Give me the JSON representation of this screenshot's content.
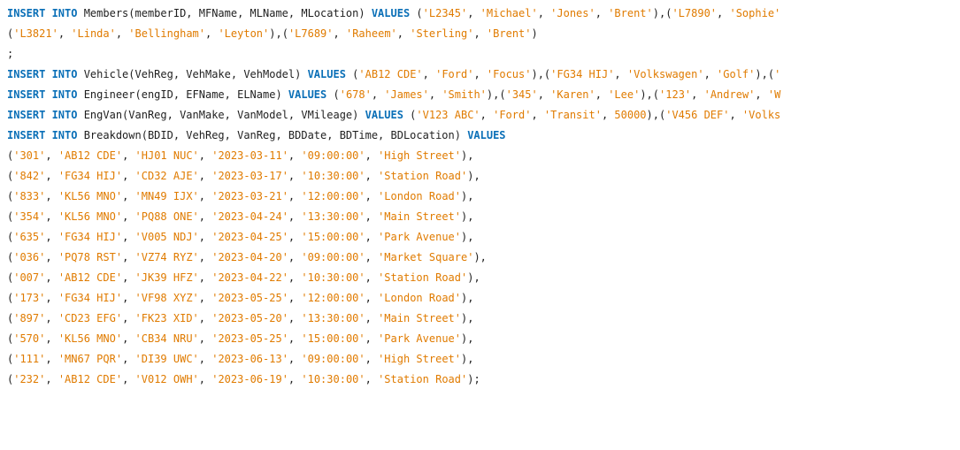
{
  "colors": {
    "keyword": "#0a6fb7",
    "string": "#e07b00",
    "text": "#1f1f1f",
    "background": "#ffffff"
  },
  "lines": [
    [
      {
        "t": "kw",
        "v": "INSERT INTO"
      },
      {
        "t": "ident",
        "v": " Members(memberID, MFName, MLName, MLocation) "
      },
      {
        "t": "kw",
        "v": "VALUES"
      },
      {
        "t": "punc",
        "v": " ("
      },
      {
        "t": "str",
        "v": "'L2345'"
      },
      {
        "t": "punc",
        "v": ", "
      },
      {
        "t": "str",
        "v": "'Michael'"
      },
      {
        "t": "punc",
        "v": ", "
      },
      {
        "t": "str",
        "v": "'Jones'"
      },
      {
        "t": "punc",
        "v": ", "
      },
      {
        "t": "str",
        "v": "'Brent'"
      },
      {
        "t": "punc",
        "v": "),("
      },
      {
        "t": "str",
        "v": "'L7890'"
      },
      {
        "t": "punc",
        "v": ", "
      },
      {
        "t": "str",
        "v": "'Sophie'"
      }
    ],
    [
      {
        "t": "punc",
        "v": "("
      },
      {
        "t": "str",
        "v": "'L3821'"
      },
      {
        "t": "punc",
        "v": ", "
      },
      {
        "t": "str",
        "v": "'Linda'"
      },
      {
        "t": "punc",
        "v": ", "
      },
      {
        "t": "str",
        "v": "'Bellingham'"
      },
      {
        "t": "punc",
        "v": ", "
      },
      {
        "t": "str",
        "v": "'Leyton'"
      },
      {
        "t": "punc",
        "v": "),("
      },
      {
        "t": "str",
        "v": "'L7689'"
      },
      {
        "t": "punc",
        "v": ", "
      },
      {
        "t": "str",
        "v": "'Raheem'"
      },
      {
        "t": "punc",
        "v": ", "
      },
      {
        "t": "str",
        "v": "'Sterling'"
      },
      {
        "t": "punc",
        "v": ", "
      },
      {
        "t": "str",
        "v": "'Brent'"
      },
      {
        "t": "punc",
        "v": ")"
      }
    ],
    [
      {
        "t": "punc",
        "v": ";"
      }
    ],
    [
      {
        "t": "kw",
        "v": "INSERT INTO"
      },
      {
        "t": "ident",
        "v": " Vehicle(VehReg, VehMake, VehModel) "
      },
      {
        "t": "kw",
        "v": "VALUES"
      },
      {
        "t": "punc",
        "v": " ("
      },
      {
        "t": "str",
        "v": "'AB12 CDE'"
      },
      {
        "t": "punc",
        "v": ", "
      },
      {
        "t": "str",
        "v": "'Ford'"
      },
      {
        "t": "punc",
        "v": ", "
      },
      {
        "t": "str",
        "v": "'Focus'"
      },
      {
        "t": "punc",
        "v": "),("
      },
      {
        "t": "str",
        "v": "'FG34 HIJ'"
      },
      {
        "t": "punc",
        "v": ", "
      },
      {
        "t": "str",
        "v": "'Volkswagen'"
      },
      {
        "t": "punc",
        "v": ", "
      },
      {
        "t": "str",
        "v": "'Golf'"
      },
      {
        "t": "punc",
        "v": "),("
      },
      {
        "t": "str",
        "v": "'"
      }
    ],
    [
      {
        "t": "kw",
        "v": "INSERT INTO"
      },
      {
        "t": "ident",
        "v": " Engineer(engID, EFName, ELName) "
      },
      {
        "t": "kw",
        "v": "VALUES"
      },
      {
        "t": "punc",
        "v": " ("
      },
      {
        "t": "str",
        "v": "'678'"
      },
      {
        "t": "punc",
        "v": ", "
      },
      {
        "t": "str",
        "v": "'James'"
      },
      {
        "t": "punc",
        "v": ", "
      },
      {
        "t": "str",
        "v": "'Smith'"
      },
      {
        "t": "punc",
        "v": "),("
      },
      {
        "t": "str",
        "v": "'345'"
      },
      {
        "t": "punc",
        "v": ", "
      },
      {
        "t": "str",
        "v": "'Karen'"
      },
      {
        "t": "punc",
        "v": ", "
      },
      {
        "t": "str",
        "v": "'Lee'"
      },
      {
        "t": "punc",
        "v": "),("
      },
      {
        "t": "str",
        "v": "'123'"
      },
      {
        "t": "punc",
        "v": ", "
      },
      {
        "t": "str",
        "v": "'Andrew'"
      },
      {
        "t": "punc",
        "v": ", "
      },
      {
        "t": "str",
        "v": "'W"
      }
    ],
    [
      {
        "t": "kw",
        "v": "INSERT INTO"
      },
      {
        "t": "ident",
        "v": " EngVan(VanReg, VanMake, VanModel, VMileage) "
      },
      {
        "t": "kw",
        "v": "VALUES"
      },
      {
        "t": "punc",
        "v": " ("
      },
      {
        "t": "str",
        "v": "'V123 ABC'"
      },
      {
        "t": "punc",
        "v": ", "
      },
      {
        "t": "str",
        "v": "'Ford'"
      },
      {
        "t": "punc",
        "v": ", "
      },
      {
        "t": "str",
        "v": "'Transit'"
      },
      {
        "t": "punc",
        "v": ", "
      },
      {
        "t": "num",
        "v": "50000"
      },
      {
        "t": "punc",
        "v": "),("
      },
      {
        "t": "str",
        "v": "'V456 DEF'"
      },
      {
        "t": "punc",
        "v": ", "
      },
      {
        "t": "str",
        "v": "'Volks"
      }
    ],
    [
      {
        "t": "kw",
        "v": "INSERT INTO"
      },
      {
        "t": "ident",
        "v": " Breakdown(BDID, VehReg, VanReg, BDDate, BDTime, BDLocation) "
      },
      {
        "t": "kw",
        "v": "VALUES"
      }
    ],
    [
      {
        "t": "punc",
        "v": "("
      },
      {
        "t": "str",
        "v": "'301'"
      },
      {
        "t": "punc",
        "v": ", "
      },
      {
        "t": "str",
        "v": "'AB12 CDE'"
      },
      {
        "t": "punc",
        "v": ", "
      },
      {
        "t": "str",
        "v": "'HJ01 NUC'"
      },
      {
        "t": "punc",
        "v": ", "
      },
      {
        "t": "str",
        "v": "'2023-03-11'"
      },
      {
        "t": "punc",
        "v": ", "
      },
      {
        "t": "str",
        "v": "'09:00:00'"
      },
      {
        "t": "punc",
        "v": ", "
      },
      {
        "t": "str",
        "v": "'High Street'"
      },
      {
        "t": "punc",
        "v": "),"
      }
    ],
    [
      {
        "t": "punc",
        "v": "("
      },
      {
        "t": "str",
        "v": "'842'"
      },
      {
        "t": "punc",
        "v": ", "
      },
      {
        "t": "str",
        "v": "'FG34 HIJ'"
      },
      {
        "t": "punc",
        "v": ", "
      },
      {
        "t": "str",
        "v": "'CD32 AJE'"
      },
      {
        "t": "punc",
        "v": ", "
      },
      {
        "t": "str",
        "v": "'2023-03-17'"
      },
      {
        "t": "punc",
        "v": ", "
      },
      {
        "t": "str",
        "v": "'10:30:00'"
      },
      {
        "t": "punc",
        "v": ", "
      },
      {
        "t": "str",
        "v": "'Station Road'"
      },
      {
        "t": "punc",
        "v": "),"
      }
    ],
    [
      {
        "t": "punc",
        "v": "("
      },
      {
        "t": "str",
        "v": "'833'"
      },
      {
        "t": "punc",
        "v": ", "
      },
      {
        "t": "str",
        "v": "'KL56 MNO'"
      },
      {
        "t": "punc",
        "v": ", "
      },
      {
        "t": "str",
        "v": "'MN49 IJX'"
      },
      {
        "t": "punc",
        "v": ", "
      },
      {
        "t": "str",
        "v": "'2023-03-21'"
      },
      {
        "t": "punc",
        "v": ", "
      },
      {
        "t": "str",
        "v": "'12:00:00'"
      },
      {
        "t": "punc",
        "v": ", "
      },
      {
        "t": "str",
        "v": "'London Road'"
      },
      {
        "t": "punc",
        "v": "),"
      }
    ],
    [
      {
        "t": "punc",
        "v": "("
      },
      {
        "t": "str",
        "v": "'354'"
      },
      {
        "t": "punc",
        "v": ", "
      },
      {
        "t": "str",
        "v": "'KL56 MNO'"
      },
      {
        "t": "punc",
        "v": ", "
      },
      {
        "t": "str",
        "v": "'PQ88 ONE'"
      },
      {
        "t": "punc",
        "v": ", "
      },
      {
        "t": "str",
        "v": "'2023-04-24'"
      },
      {
        "t": "punc",
        "v": ", "
      },
      {
        "t": "str",
        "v": "'13:30:00'"
      },
      {
        "t": "punc",
        "v": ", "
      },
      {
        "t": "str",
        "v": "'Main Street'"
      },
      {
        "t": "punc",
        "v": "),"
      }
    ],
    [
      {
        "t": "punc",
        "v": "("
      },
      {
        "t": "str",
        "v": "'635'"
      },
      {
        "t": "punc",
        "v": ", "
      },
      {
        "t": "str",
        "v": "'FG34 HIJ'"
      },
      {
        "t": "punc",
        "v": ", "
      },
      {
        "t": "str",
        "v": "'V005 NDJ'"
      },
      {
        "t": "punc",
        "v": ", "
      },
      {
        "t": "str",
        "v": "'2023-04-25'"
      },
      {
        "t": "punc",
        "v": ", "
      },
      {
        "t": "str",
        "v": "'15:00:00'"
      },
      {
        "t": "punc",
        "v": ", "
      },
      {
        "t": "str",
        "v": "'Park Avenue'"
      },
      {
        "t": "punc",
        "v": "),"
      }
    ],
    [
      {
        "t": "punc",
        "v": "("
      },
      {
        "t": "str",
        "v": "'036'"
      },
      {
        "t": "punc",
        "v": ", "
      },
      {
        "t": "str",
        "v": "'PQ78 RST'"
      },
      {
        "t": "punc",
        "v": ", "
      },
      {
        "t": "str",
        "v": "'VZ74 RYZ'"
      },
      {
        "t": "punc",
        "v": ", "
      },
      {
        "t": "str",
        "v": "'2023-04-20'"
      },
      {
        "t": "punc",
        "v": ", "
      },
      {
        "t": "str",
        "v": "'09:00:00'"
      },
      {
        "t": "punc",
        "v": ", "
      },
      {
        "t": "str",
        "v": "'Market Square'"
      },
      {
        "t": "punc",
        "v": "),"
      }
    ],
    [
      {
        "t": "punc",
        "v": "("
      },
      {
        "t": "str",
        "v": "'007'"
      },
      {
        "t": "punc",
        "v": ", "
      },
      {
        "t": "str",
        "v": "'AB12 CDE'"
      },
      {
        "t": "punc",
        "v": ", "
      },
      {
        "t": "str",
        "v": "'JK39 HFZ'"
      },
      {
        "t": "punc",
        "v": ", "
      },
      {
        "t": "str",
        "v": "'2023-04-22'"
      },
      {
        "t": "punc",
        "v": ", "
      },
      {
        "t": "str",
        "v": "'10:30:00'"
      },
      {
        "t": "punc",
        "v": ", "
      },
      {
        "t": "str",
        "v": "'Station Road'"
      },
      {
        "t": "punc",
        "v": "),"
      }
    ],
    [
      {
        "t": "punc",
        "v": "("
      },
      {
        "t": "str",
        "v": "'173'"
      },
      {
        "t": "punc",
        "v": ", "
      },
      {
        "t": "str",
        "v": "'FG34 HIJ'"
      },
      {
        "t": "punc",
        "v": ", "
      },
      {
        "t": "str",
        "v": "'VF98 XYZ'"
      },
      {
        "t": "punc",
        "v": ", "
      },
      {
        "t": "str",
        "v": "'2023-05-25'"
      },
      {
        "t": "punc",
        "v": ", "
      },
      {
        "t": "str",
        "v": "'12:00:00'"
      },
      {
        "t": "punc",
        "v": ", "
      },
      {
        "t": "str",
        "v": "'London Road'"
      },
      {
        "t": "punc",
        "v": "),"
      }
    ],
    [
      {
        "t": "punc",
        "v": "("
      },
      {
        "t": "str",
        "v": "'897'"
      },
      {
        "t": "punc",
        "v": ", "
      },
      {
        "t": "str",
        "v": "'CD23 EFG'"
      },
      {
        "t": "punc",
        "v": ", "
      },
      {
        "t": "str",
        "v": "'FK23 XID'"
      },
      {
        "t": "punc",
        "v": ", "
      },
      {
        "t": "str",
        "v": "'2023-05-20'"
      },
      {
        "t": "punc",
        "v": ", "
      },
      {
        "t": "str",
        "v": "'13:30:00'"
      },
      {
        "t": "punc",
        "v": ", "
      },
      {
        "t": "str",
        "v": "'Main Street'"
      },
      {
        "t": "punc",
        "v": "),"
      }
    ],
    [
      {
        "t": "punc",
        "v": "("
      },
      {
        "t": "str",
        "v": "'570'"
      },
      {
        "t": "punc",
        "v": ", "
      },
      {
        "t": "str",
        "v": "'KL56 MNO'"
      },
      {
        "t": "punc",
        "v": ", "
      },
      {
        "t": "str",
        "v": "'CB34 NRU'"
      },
      {
        "t": "punc",
        "v": ", "
      },
      {
        "t": "str",
        "v": "'2023-05-25'"
      },
      {
        "t": "punc",
        "v": ", "
      },
      {
        "t": "str",
        "v": "'15:00:00'"
      },
      {
        "t": "punc",
        "v": ", "
      },
      {
        "t": "str",
        "v": "'Park Avenue'"
      },
      {
        "t": "punc",
        "v": "),"
      }
    ],
    [
      {
        "t": "punc",
        "v": "("
      },
      {
        "t": "str",
        "v": "'111'"
      },
      {
        "t": "punc",
        "v": ", "
      },
      {
        "t": "str",
        "v": "'MN67 PQR'"
      },
      {
        "t": "punc",
        "v": ", "
      },
      {
        "t": "str",
        "v": "'DI39 UWC'"
      },
      {
        "t": "punc",
        "v": ", "
      },
      {
        "t": "str",
        "v": "'2023-06-13'"
      },
      {
        "t": "punc",
        "v": ", "
      },
      {
        "t": "str",
        "v": "'09:00:00'"
      },
      {
        "t": "punc",
        "v": ", "
      },
      {
        "t": "str",
        "v": "'High Street'"
      },
      {
        "t": "punc",
        "v": "),"
      }
    ],
    [
      {
        "t": "punc",
        "v": "("
      },
      {
        "t": "str",
        "v": "'232'"
      },
      {
        "t": "punc",
        "v": ", "
      },
      {
        "t": "str",
        "v": "'AB12 CDE'"
      },
      {
        "t": "punc",
        "v": ", "
      },
      {
        "t": "str",
        "v": "'V012 OWH'"
      },
      {
        "t": "punc",
        "v": ", "
      },
      {
        "t": "str",
        "v": "'2023-06-19'"
      },
      {
        "t": "punc",
        "v": ", "
      },
      {
        "t": "str",
        "v": "'10:30:00'"
      },
      {
        "t": "punc",
        "v": ", "
      },
      {
        "t": "str",
        "v": "'Station Road'"
      },
      {
        "t": "punc",
        "v": ");"
      }
    ]
  ]
}
